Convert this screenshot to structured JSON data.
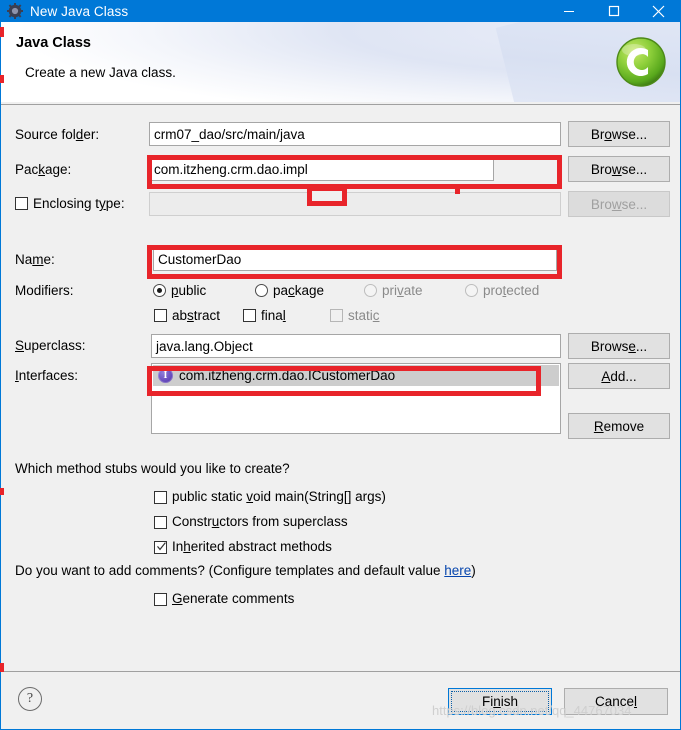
{
  "window": {
    "title": "New Java Class",
    "icon": "gear-icon",
    "controls": {
      "minimize": "minimize-icon",
      "maximize": "maximize-icon",
      "close": "close-icon"
    },
    "accent_color": "#0078d7"
  },
  "header": {
    "title": "Java Class",
    "description": "Create a new Java class.",
    "logo": "new-java-class-icon"
  },
  "form": {
    "source_folder": {
      "label": "Source folder:",
      "value": "crm07_dao/src/main/java",
      "browse": "Browse..."
    },
    "package": {
      "label": "Package:",
      "value": "com.itzheng.crm.dao.impl",
      "browse": "Browse..."
    },
    "enclosing_type": {
      "label": "Enclosing type:",
      "checked": false,
      "value": "",
      "browse": "Browse...",
      "disabled": true
    },
    "name": {
      "label": "Name:",
      "value": "CustomerDao"
    },
    "modifiers": {
      "label": "Modifiers:",
      "access": [
        {
          "label": "public",
          "selected": true,
          "disabled": false
        },
        {
          "label": "package",
          "selected": false,
          "disabled": false
        },
        {
          "label": "private",
          "selected": false,
          "disabled": true
        },
        {
          "label": "protected",
          "selected": false,
          "disabled": true
        }
      ],
      "flags": [
        {
          "label": "abstract",
          "checked": false,
          "disabled": false
        },
        {
          "label": "final",
          "checked": false,
          "disabled": false
        },
        {
          "label": "static",
          "checked": false,
          "disabled": true
        }
      ]
    },
    "superclass": {
      "label": "Superclass:",
      "value": "java.lang.Object",
      "browse": "Browse..."
    },
    "interfaces": {
      "label": "Interfaces:",
      "items": [
        {
          "name": "com.itzheng.crm.dao.ICustomerDao",
          "icon": "interface-icon",
          "selected": true
        }
      ],
      "add": "Add...",
      "remove": "Remove"
    }
  },
  "stubs": {
    "question": "Which method stubs would you like to create?",
    "options": [
      {
        "label": "public static void main(String[] args)",
        "checked": false
      },
      {
        "label": "Constructors from superclass",
        "checked": false
      },
      {
        "label": "Inherited abstract methods",
        "checked": true
      }
    ]
  },
  "comments": {
    "question_prefix": "Do you want to add comments? (Configure templates and default value ",
    "link": "here",
    "question_suffix": ")",
    "option": {
      "label": "Generate comments",
      "checked": false
    }
  },
  "footer": {
    "help": "?",
    "finish": "Finish",
    "cancel": "Cancel"
  },
  "watermark": "https://blog.csdn.net/qq_44767034"
}
